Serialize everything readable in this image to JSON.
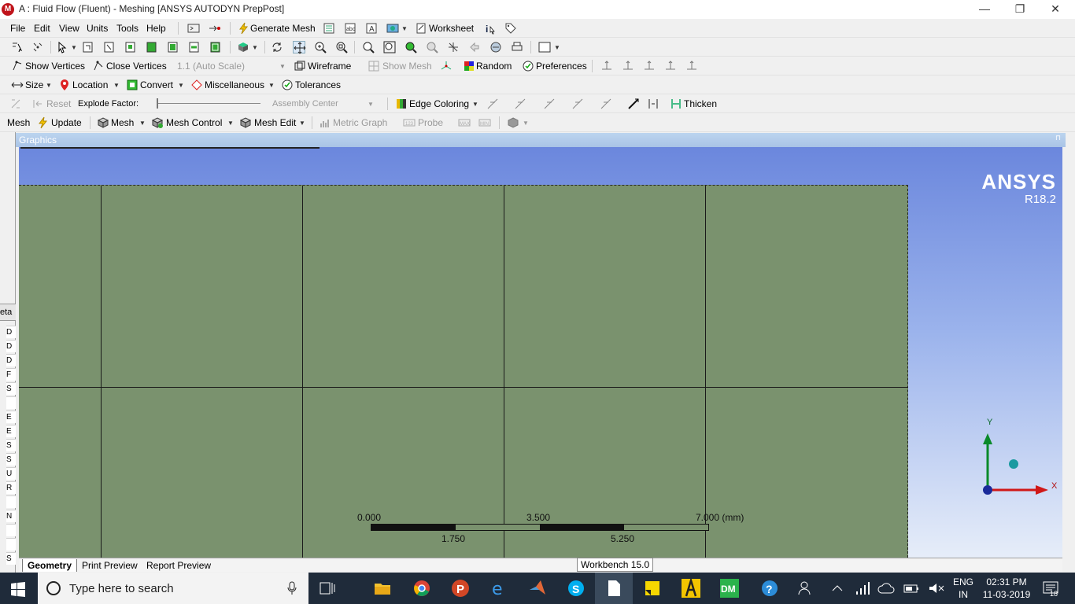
{
  "window": {
    "title": "A : Fluid Flow (Fluent) - Meshing [ANSYS AUTODYN PrepPost]",
    "app_icon": "M",
    "minimize": "—",
    "restore": "❐",
    "close": "✕"
  },
  "menu": [
    "File",
    "Edit",
    "View",
    "Units",
    "Tools",
    "Help"
  ],
  "toolbar1": {
    "generate_mesh": "Generate Mesh",
    "worksheet": "Worksheet"
  },
  "toolbar3": {
    "show_vertices": "Show Vertices",
    "close_vertices": "Close Vertices",
    "scale_select": "1.1 (Auto Scale)",
    "wireframe": "Wireframe",
    "show_mesh": "Show Mesh",
    "random": "Random",
    "preferences": "Preferences"
  },
  "toolbar4": {
    "size": "Size",
    "location": "Location",
    "convert": "Convert",
    "miscellaneous": "Miscellaneous",
    "tolerances": "Tolerances"
  },
  "toolbar5": {
    "reset": "Reset",
    "explode_factor": "Explode Factor:",
    "assembly_center": "Assembly Center",
    "edge_coloring": "Edge Coloring",
    "thicken": "Thicken"
  },
  "toolbar6": {
    "mesh": "Mesh",
    "update": "Update",
    "mesh_menu": "Mesh",
    "mesh_control": "Mesh Control",
    "mesh_edit": "Mesh Edit",
    "metric_graph": "Metric Graph",
    "probe": "Probe"
  },
  "left_panel": {
    "heading": "eta",
    "rows": [
      "D",
      "D",
      "D",
      "F",
      "S",
      "",
      "E",
      "E",
      "S",
      "S",
      "U",
      "R",
      "",
      "N",
      "",
      "",
      "S"
    ]
  },
  "graphics": {
    "header": "Graphics",
    "logo_name": "ANSYS",
    "logo_version": "R18.2",
    "scale": {
      "top_labels": [
        "0.000",
        "3.500",
        "7.000 (mm)"
      ],
      "bottom_labels": [
        "1.750",
        "5.250"
      ]
    },
    "triad": {
      "y": "Y",
      "x": "X"
    }
  },
  "bottom_tabs": [
    "Geometry",
    "Print Preview",
    "Report Preview"
  ],
  "tooltip": "Workbench 15.0",
  "taskbar": {
    "search_placeholder": "Type here to search",
    "lang_top": "ENG",
    "lang_bottom": "IN",
    "time": "02:31 PM",
    "date": "11-03-2019",
    "notifications": "18"
  }
}
